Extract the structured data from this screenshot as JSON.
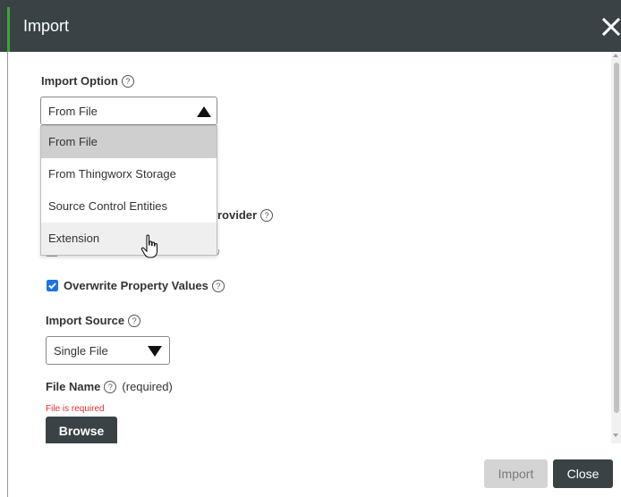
{
  "dialog": {
    "title": "Import"
  },
  "import_option": {
    "label": "Import Option",
    "selected": "From File",
    "options": [
      "From File",
      "From Thingworx Storage",
      "Source Control Entities",
      "Extension"
    ]
  },
  "hidden_fields": {
    "provider_fragment": "rovider"
  },
  "overwrite": {
    "label": "Overwrite Property Values",
    "checked": true
  },
  "import_source": {
    "label": "Import Source",
    "selected": "Single File"
  },
  "file_name": {
    "label": "File Name",
    "required_text": "(required)",
    "error": "File is required"
  },
  "buttons": {
    "browse": "Browse",
    "import": "Import",
    "close": "Close"
  },
  "icons": {
    "help": "?",
    "close": "close-icon",
    "dropdown": "triangle-icon",
    "cursor": "hand-pointer-icon"
  },
  "colors": {
    "titlebar": "#3b4245",
    "accent": "#3ba538",
    "checkbox": "#1a73e8",
    "error": "#e0302f",
    "hover": "#d6d6d6"
  }
}
